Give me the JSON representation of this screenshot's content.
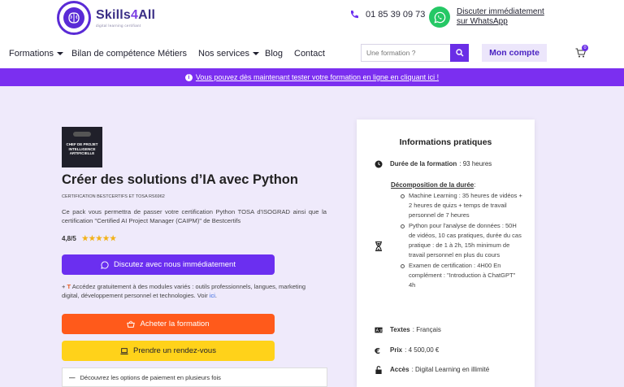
{
  "header": {
    "brand": "Skills4All",
    "tagline": "digital learning certifiant",
    "phone": "01 85 39 09 73",
    "whatsapp_link": "Discuter immédiatement sur WhatsApp"
  },
  "nav": {
    "items": [
      "Formations",
      "Bilan de compétence",
      "Métiers",
      "Nos services",
      "Blog",
      "Contact"
    ],
    "search_placeholder": "Une formation ?",
    "account_label": "Mon compte",
    "cart_count": "0"
  },
  "banner": {
    "text": "Vous pouvez dès maintenant tester votre formation en ligne en cliquant ici !"
  },
  "course": {
    "badge_text": "CHEF DE PROJET INTELLIGENCE ARTIFICIELLE",
    "title": "Créer des solutions d’IA avec Python",
    "subtitle": "CERTIFICATION BESTCERTIFS ET TOSA RS6962",
    "description": "Ce pack vous permettra de passer votre certification Python TOSA d'ISOGRAD ainsi que la certification \"Certified AI Project Manager (CAIPM)\" de Bestcertifs",
    "rating": "4,8/5",
    "rating_stars": 4.8,
    "discuss_button": "Discutez avec nous immédiatement",
    "free_note_prefix": "+",
    "free_note": "Accédez gratuitement à des modules variés : outils professionnels, langues, marketing digital, développement personnel et technologies. Voir",
    "free_note_link": "ici",
    "buy_button": "Acheter la formation",
    "rdv_button": "Prendre un rendez-vous",
    "payment_toggle": "Découvrez les options de paiement en plusieurs fois"
  },
  "info": {
    "title": "Informations pratiques",
    "duration_label": "Durée de la formation",
    "duration_value": ": 93 heures",
    "decomp_label": "Décomposition de la durée",
    "decomp_items": [
      "Machine Learning : 35 heures de vidéos + 2 heures de quizs + temps de travail personnel de 7 heures",
      "Python pour l'analyse de données : 50H de vidéos, 10 cas pratiques, durée du cas pratique : de 1 à 2h, 15h minimum de travail personnel en plus du cours",
      "Examen de certification : 4H00 En complément : \"Introduction à ChatGPT\" 4h"
    ],
    "texts_label": "Textes",
    "texts_value": ": Français",
    "price_label": "Prix",
    "price_value": ": 4 500,00 €",
    "access_label": "Accès",
    "access_value": ": Digital Learning en illimité"
  },
  "colors": {
    "purple": "#6b2ff0",
    "orange": "#ff5a1b",
    "yellow": "#ffd21a",
    "whatsapp": "#25c865",
    "background": "#efeafb"
  }
}
